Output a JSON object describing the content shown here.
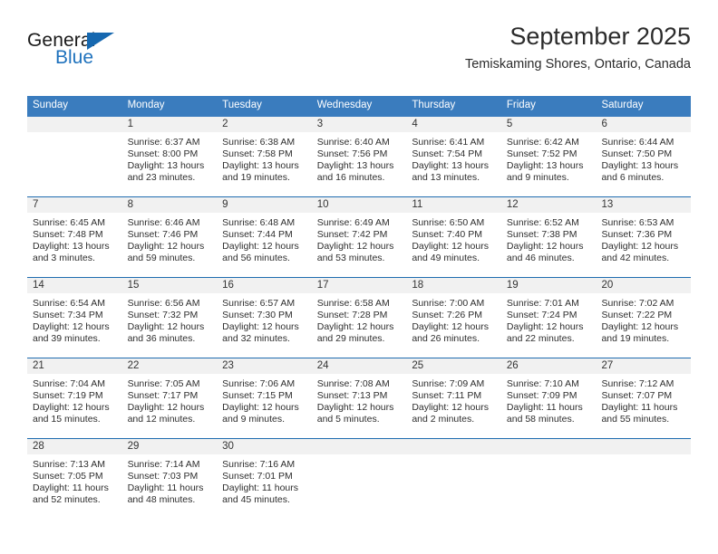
{
  "brand": {
    "name_top": "General",
    "name_bottom": "Blue",
    "triangle_icon": "triangle-icon",
    "color_blue": "#1f72bd",
    "color_dark": "#1a1a1a"
  },
  "header": {
    "title": "September 2025",
    "subtitle": "Temiskaming Shores, Ontario, Canada"
  },
  "theme": {
    "header_bg": "#3a7cbe",
    "header_text": "#ffffff",
    "row_divider": "#1f6cb0",
    "daynum_bg": "#f1f1f1"
  },
  "weekdays": [
    "Sunday",
    "Monday",
    "Tuesday",
    "Wednesday",
    "Thursday",
    "Friday",
    "Saturday"
  ],
  "weeks": [
    [
      {
        "day": "",
        "lines": []
      },
      {
        "day": "1",
        "lines": [
          "Sunrise: 6:37 AM",
          "Sunset: 8:00 PM",
          "Daylight: 13 hours",
          "and 23 minutes."
        ]
      },
      {
        "day": "2",
        "lines": [
          "Sunrise: 6:38 AM",
          "Sunset: 7:58 PM",
          "Daylight: 13 hours",
          "and 19 minutes."
        ]
      },
      {
        "day": "3",
        "lines": [
          "Sunrise: 6:40 AM",
          "Sunset: 7:56 PM",
          "Daylight: 13 hours",
          "and 16 minutes."
        ]
      },
      {
        "day": "4",
        "lines": [
          "Sunrise: 6:41 AM",
          "Sunset: 7:54 PM",
          "Daylight: 13 hours",
          "and 13 minutes."
        ]
      },
      {
        "day": "5",
        "lines": [
          "Sunrise: 6:42 AM",
          "Sunset: 7:52 PM",
          "Daylight: 13 hours",
          "and 9 minutes."
        ]
      },
      {
        "day": "6",
        "lines": [
          "Sunrise: 6:44 AM",
          "Sunset: 7:50 PM",
          "Daylight: 13 hours",
          "and 6 minutes."
        ]
      }
    ],
    [
      {
        "day": "7",
        "lines": [
          "Sunrise: 6:45 AM",
          "Sunset: 7:48 PM",
          "Daylight: 13 hours",
          "and 3 minutes."
        ]
      },
      {
        "day": "8",
        "lines": [
          "Sunrise: 6:46 AM",
          "Sunset: 7:46 PM",
          "Daylight: 12 hours",
          "and 59 minutes."
        ]
      },
      {
        "day": "9",
        "lines": [
          "Sunrise: 6:48 AM",
          "Sunset: 7:44 PM",
          "Daylight: 12 hours",
          "and 56 minutes."
        ]
      },
      {
        "day": "10",
        "lines": [
          "Sunrise: 6:49 AM",
          "Sunset: 7:42 PM",
          "Daylight: 12 hours",
          "and 53 minutes."
        ]
      },
      {
        "day": "11",
        "lines": [
          "Sunrise: 6:50 AM",
          "Sunset: 7:40 PM",
          "Daylight: 12 hours",
          "and 49 minutes."
        ]
      },
      {
        "day": "12",
        "lines": [
          "Sunrise: 6:52 AM",
          "Sunset: 7:38 PM",
          "Daylight: 12 hours",
          "and 46 minutes."
        ]
      },
      {
        "day": "13",
        "lines": [
          "Sunrise: 6:53 AM",
          "Sunset: 7:36 PM",
          "Daylight: 12 hours",
          "and 42 minutes."
        ]
      }
    ],
    [
      {
        "day": "14",
        "lines": [
          "Sunrise: 6:54 AM",
          "Sunset: 7:34 PM",
          "Daylight: 12 hours",
          "and 39 minutes."
        ]
      },
      {
        "day": "15",
        "lines": [
          "Sunrise: 6:56 AM",
          "Sunset: 7:32 PM",
          "Daylight: 12 hours",
          "and 36 minutes."
        ]
      },
      {
        "day": "16",
        "lines": [
          "Sunrise: 6:57 AM",
          "Sunset: 7:30 PM",
          "Daylight: 12 hours",
          "and 32 minutes."
        ]
      },
      {
        "day": "17",
        "lines": [
          "Sunrise: 6:58 AM",
          "Sunset: 7:28 PM",
          "Daylight: 12 hours",
          "and 29 minutes."
        ]
      },
      {
        "day": "18",
        "lines": [
          "Sunrise: 7:00 AM",
          "Sunset: 7:26 PM",
          "Daylight: 12 hours",
          "and 26 minutes."
        ]
      },
      {
        "day": "19",
        "lines": [
          "Sunrise: 7:01 AM",
          "Sunset: 7:24 PM",
          "Daylight: 12 hours",
          "and 22 minutes."
        ]
      },
      {
        "day": "20",
        "lines": [
          "Sunrise: 7:02 AM",
          "Sunset: 7:22 PM",
          "Daylight: 12 hours",
          "and 19 minutes."
        ]
      }
    ],
    [
      {
        "day": "21",
        "lines": [
          "Sunrise: 7:04 AM",
          "Sunset: 7:19 PM",
          "Daylight: 12 hours",
          "and 15 minutes."
        ]
      },
      {
        "day": "22",
        "lines": [
          "Sunrise: 7:05 AM",
          "Sunset: 7:17 PM",
          "Daylight: 12 hours",
          "and 12 minutes."
        ]
      },
      {
        "day": "23",
        "lines": [
          "Sunrise: 7:06 AM",
          "Sunset: 7:15 PM",
          "Daylight: 12 hours",
          "and 9 minutes."
        ]
      },
      {
        "day": "24",
        "lines": [
          "Sunrise: 7:08 AM",
          "Sunset: 7:13 PM",
          "Daylight: 12 hours",
          "and 5 minutes."
        ]
      },
      {
        "day": "25",
        "lines": [
          "Sunrise: 7:09 AM",
          "Sunset: 7:11 PM",
          "Daylight: 12 hours",
          "and 2 minutes."
        ]
      },
      {
        "day": "26",
        "lines": [
          "Sunrise: 7:10 AM",
          "Sunset: 7:09 PM",
          "Daylight: 11 hours",
          "and 58 minutes."
        ]
      },
      {
        "day": "27",
        "lines": [
          "Sunrise: 7:12 AM",
          "Sunset: 7:07 PM",
          "Daylight: 11 hours",
          "and 55 minutes."
        ]
      }
    ],
    [
      {
        "day": "28",
        "lines": [
          "Sunrise: 7:13 AM",
          "Sunset: 7:05 PM",
          "Daylight: 11 hours",
          "and 52 minutes."
        ]
      },
      {
        "day": "29",
        "lines": [
          "Sunrise: 7:14 AM",
          "Sunset: 7:03 PM",
          "Daylight: 11 hours",
          "and 48 minutes."
        ]
      },
      {
        "day": "30",
        "lines": [
          "Sunrise: 7:16 AM",
          "Sunset: 7:01 PM",
          "Daylight: 11 hours",
          "and 45 minutes."
        ]
      },
      {
        "day": "",
        "lines": []
      },
      {
        "day": "",
        "lines": []
      },
      {
        "day": "",
        "lines": []
      },
      {
        "day": "",
        "lines": []
      }
    ]
  ]
}
